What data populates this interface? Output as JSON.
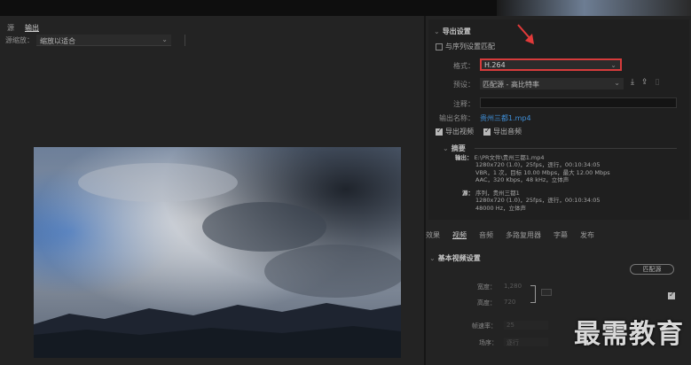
{
  "left_panel": {
    "tabs": [
      "源",
      "输出"
    ],
    "source_scale_label": "源缩放：",
    "source_scale_value": "缩放以适合"
  },
  "export_settings": {
    "title": "导出设置",
    "match_sequence": "与序列设置匹配",
    "format_label": "格式：",
    "format_value": "H.264",
    "preset_label": "预设：",
    "preset_value": "匹配源 - 高比特率",
    "comment_label": "注释：",
    "output_name_label": "输出名称：",
    "output_name_value": "贵州三都1.mp4",
    "export_video": "导出视频",
    "export_audio": "导出音频",
    "summary_title": "摘要",
    "output_label": "输出：",
    "output_lines": [
      "E:\\PR文件\\贵州三都1.mp4",
      "1280x720 (1.0)，25fps，逐行，00:10:34:05",
      "VBR，1 次，目标 10.00 Mbps，最大 12.00 Mbps",
      "AAC，320 Kbps，48 kHz，立体声"
    ],
    "source_label": "源：",
    "source_lines": [
      "序列，贵州三都1",
      "1280x720 (1.0)，25fps，逐行，00:10:34:05",
      "48000 Hz，立体声"
    ]
  },
  "sub_tabs": [
    "效果",
    "视频",
    "音频",
    "多路复用器",
    "字幕",
    "发布"
  ],
  "active_sub_tab": "视频",
  "basic_video": {
    "title": "基本视频设置",
    "match_button": "匹配源",
    "width_label": "宽度：",
    "width_value": "1,280",
    "height_label": "高度：",
    "height_value": "720",
    "frame_rate_label": "帧速率：",
    "frame_rate_value": "25",
    "field_order_label": "场序：",
    "field_order_value": "逐行"
  },
  "watermark": "最需教育",
  "colors": {
    "highlight_border": "#d63b3b",
    "link": "#3f8fd8",
    "arrow": "#e23a3a"
  }
}
